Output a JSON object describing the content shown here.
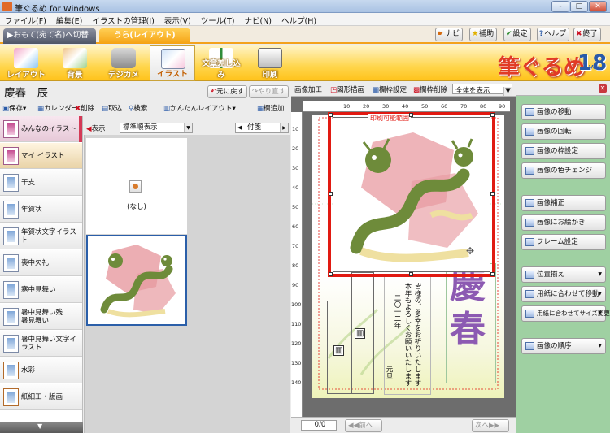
{
  "window": {
    "title": "筆ぐるめ for Windows"
  },
  "window_controls": [
    "-",
    "□",
    "✕"
  ],
  "menu": [
    "ファイル(F)",
    "編集(E)",
    "イラストの管理(I)",
    "表示(V)",
    "ツール(T)",
    "ナビ(N)",
    "ヘルプ(H)"
  ],
  "tabs": {
    "omote": "おもて(宛て名)へ切替",
    "ura": "うら(レイアウト)"
  },
  "top_buttons": [
    "ナビ",
    "補助",
    "設定",
    "ヘルプ",
    "終了"
  ],
  "toolbar": [
    "レイアウト",
    "背景",
    "デジカメ",
    "イラスト",
    "文章差し込み",
    "印刷"
  ],
  "logo": {
    "text": "筆ぐるめ",
    "ver": "Ver.",
    "number": "18"
  },
  "left": {
    "doc_title": "慶春　辰",
    "undo": "元に戻す",
    "redo": "やり直す",
    "tools": [
      "保存",
      "カレンダー",
      "削除",
      "取込",
      "検索",
      "かんたんレイアウト",
      "欄追加"
    ],
    "display_label": "表示",
    "sort_combo": "標準順表示",
    "page_combo": "付箋",
    "categories": [
      {
        "label": "みんなのイラスト"
      },
      {
        "label": "マイ イラスト"
      },
      {
        "label": "干支"
      },
      {
        "label": "年賀状"
      },
      {
        "label": "年賀状文字イラスト"
      },
      {
        "label": "喪中欠礼"
      },
      {
        "label": "寒中見舞い"
      },
      {
        "label": "暑中見舞い残暑見舞い"
      },
      {
        "label": "暑中見舞い文字イラスト"
      },
      {
        "label": "水彩"
      },
      {
        "label": "紙細工・版画"
      }
    ],
    "gallery_none": "(なし)"
  },
  "canvas": {
    "tools": [
      "画像加工",
      "図形描画",
      "欄枠設定",
      "欄枠削除"
    ],
    "zoom": "全体を表示",
    "print_range": "印刷可能範囲",
    "ruler_top": [
      "10",
      "20",
      "30",
      "40",
      "50",
      "60",
      "70",
      "80",
      "90"
    ],
    "ruler_left": [
      "10",
      "20",
      "30",
      "40",
      "50",
      "60",
      "70",
      "80",
      "90",
      "100",
      "110",
      "120",
      "130",
      "140"
    ],
    "greeting": [
      "皆様のご多幸をお祈りいたします",
      "本年もよろしくお願いいたします",
      "二〇一二年",
      "元旦"
    ],
    "kotobuki": [
      "慶",
      "春"
    ],
    "page_indicator": "0/0",
    "prev": "前へ",
    "next": "次へ"
  },
  "right": {
    "buttons": [
      {
        "label": "画像の移動"
      },
      {
        "label": "画像の回転"
      },
      {
        "label": "画像の枠設定"
      },
      {
        "label": "画像の色チェンジ"
      },
      {
        "label": "画像補正"
      },
      {
        "label": "画像にお絵かき"
      },
      {
        "label": "フレーム設定"
      },
      {
        "label": "位置揃え"
      },
      {
        "label": "用紙に合わせて移動"
      },
      {
        "label": "用紙に合わせてサイズ変更"
      },
      {
        "label": "画像の順序"
      }
    ]
  },
  "colors": {
    "accent": "#f5a213",
    "selection": "#e11a12",
    "right_panel": "#9fd0a2"
  }
}
